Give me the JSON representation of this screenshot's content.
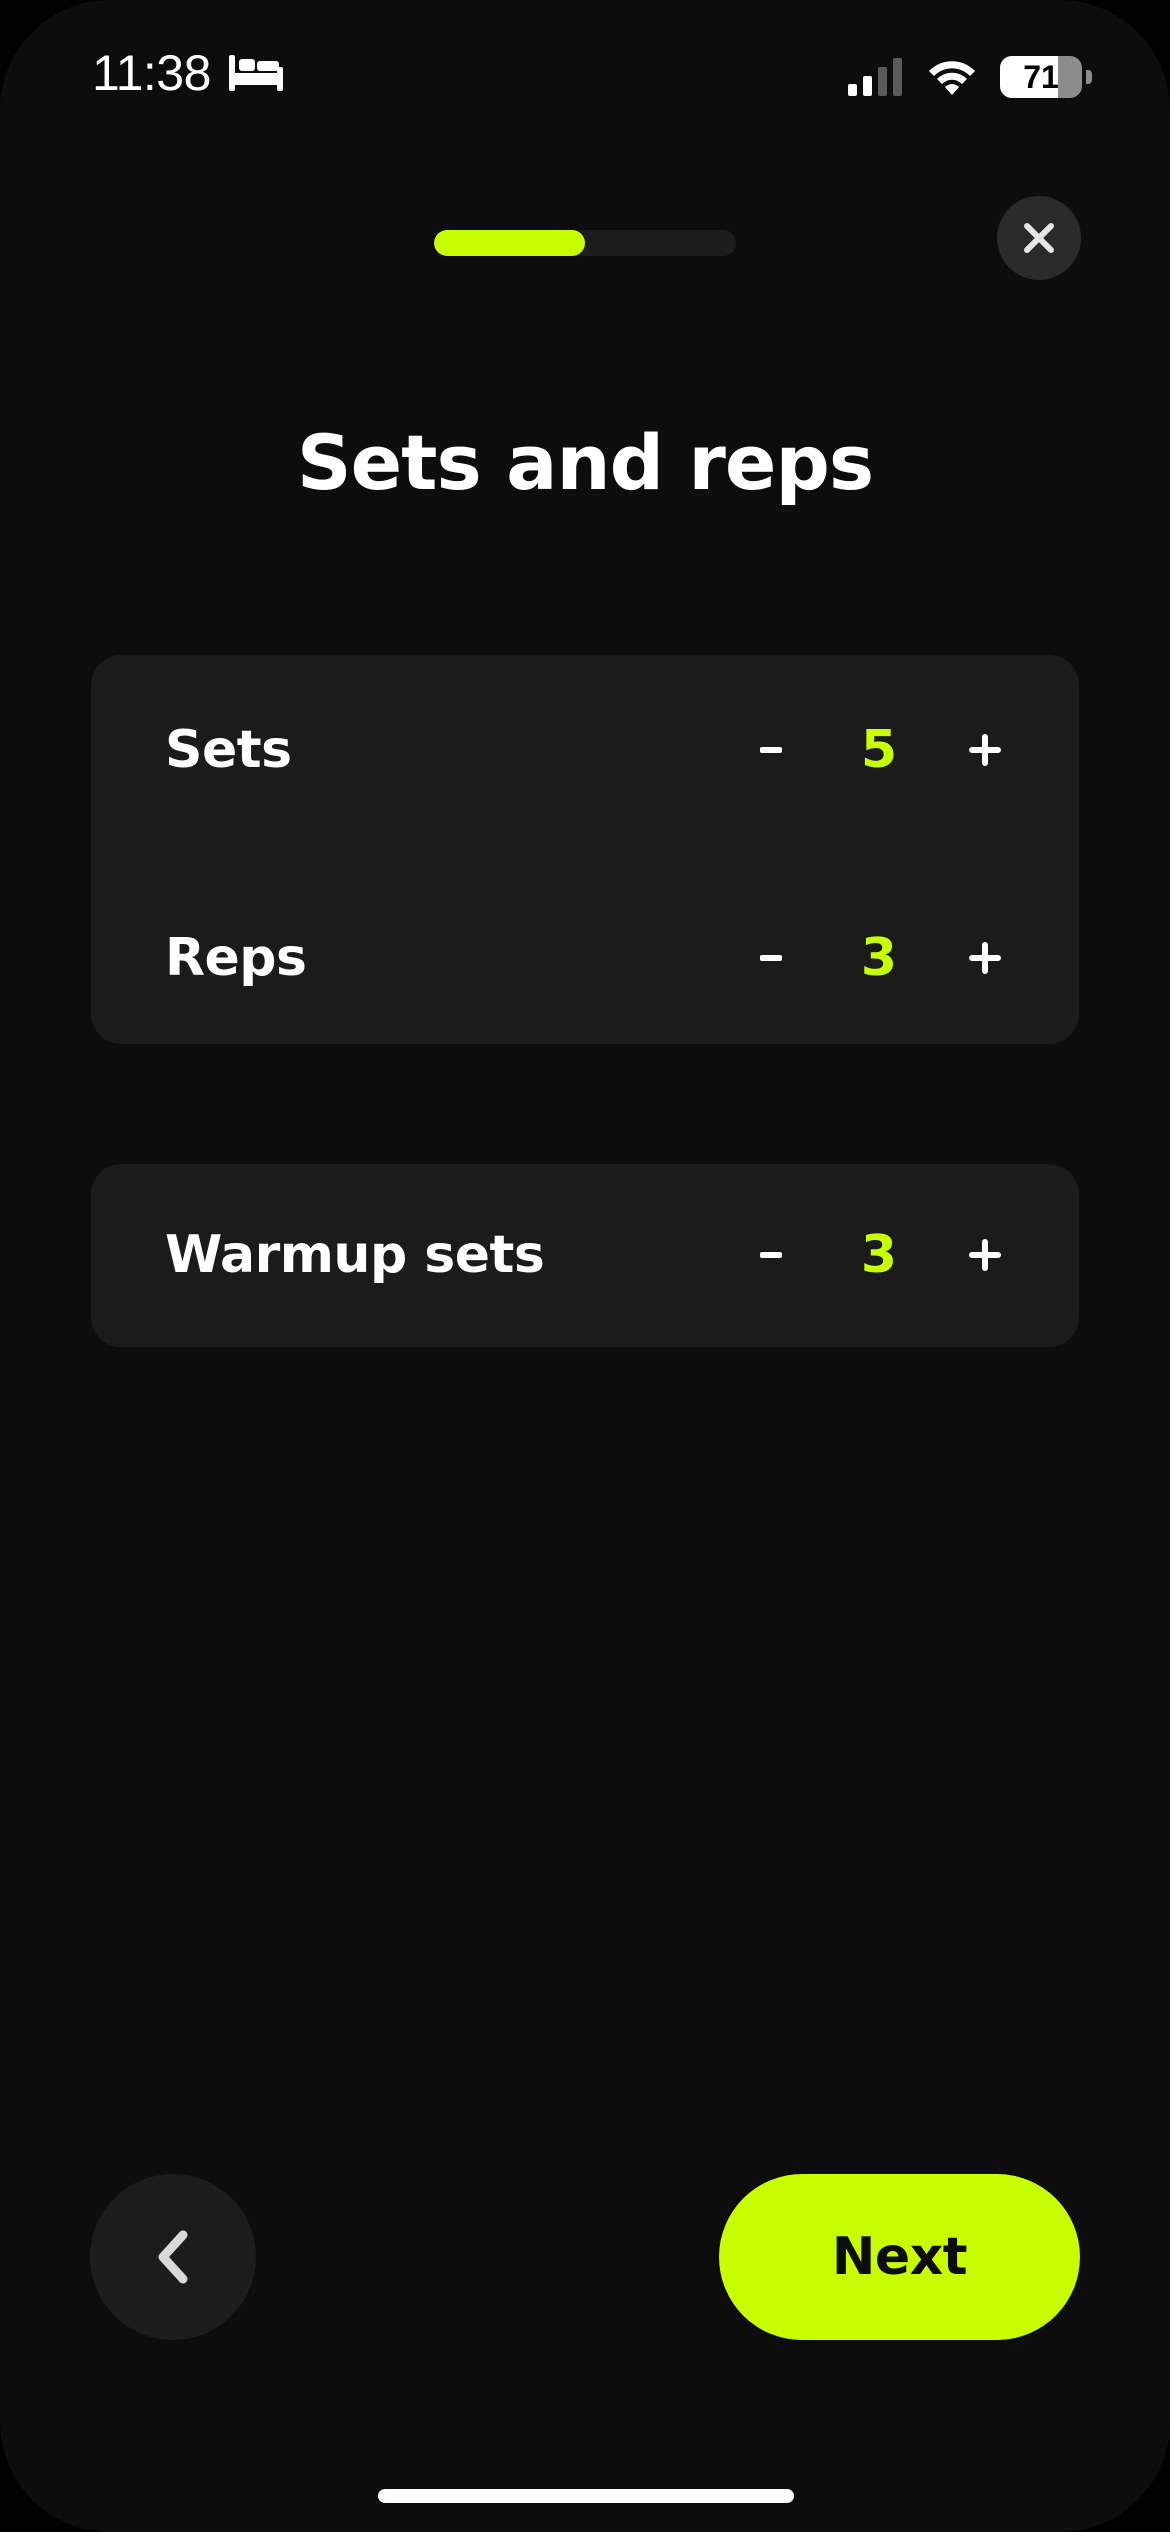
{
  "status_bar": {
    "time": "11:38",
    "battery": "71",
    "battery_level": 0.71
  },
  "progress": {
    "fraction": 0.5
  },
  "title": "Sets and reps",
  "rows": [
    {
      "label": "Sets",
      "value": "5",
      "minus": "-",
      "plus": "+"
    },
    {
      "label": "Reps",
      "value": "3",
      "minus": "-",
      "plus": "+"
    },
    {
      "label": "Warmup sets",
      "value": "3",
      "minus": "-",
      "plus": "+"
    }
  ],
  "actions": {
    "next_label": "Next"
  },
  "colors": {
    "accent": "#c8ff00",
    "background": "#0d0d0d",
    "card": "#1b1b1b"
  },
  "icons": {
    "bed": "bed-icon",
    "signal": "cellular-signal-icon",
    "wifi": "wifi-icon",
    "close": "close-icon",
    "back": "chevron-left-icon"
  }
}
